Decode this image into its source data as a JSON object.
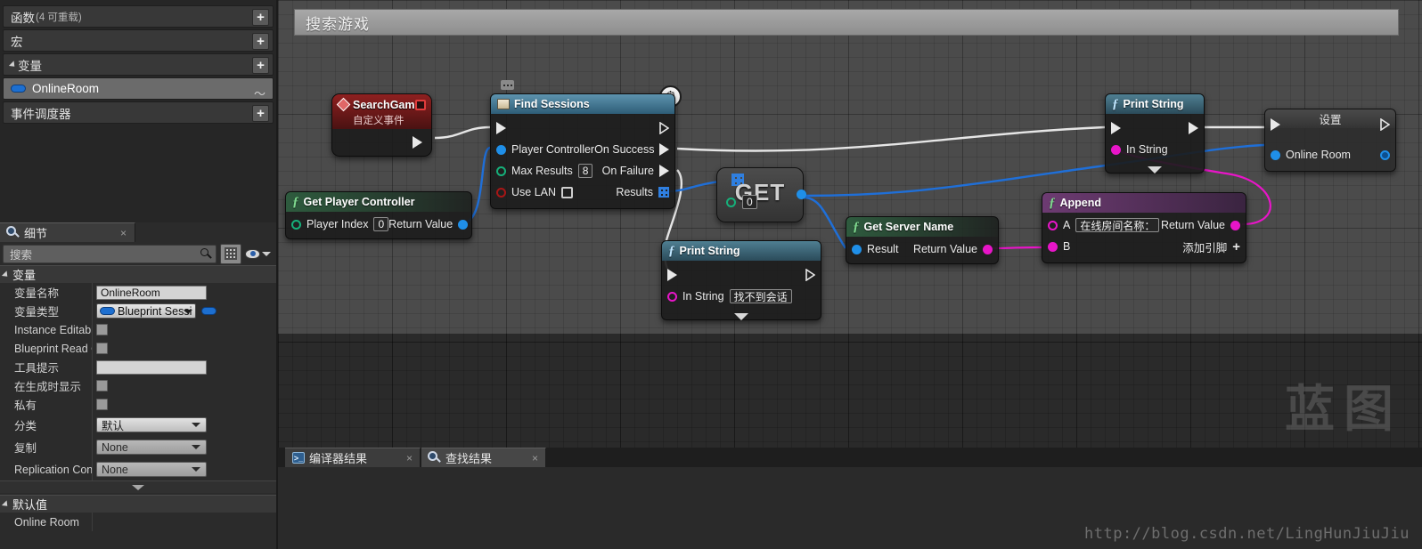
{
  "my_blueprint": {
    "rows": [
      {
        "label": "函数",
        "note": "(4 可重载)",
        "type": "section",
        "name": "functions"
      },
      {
        "label": "宏",
        "note": "",
        "type": "section",
        "name": "macros"
      },
      {
        "label": "变量",
        "note": "",
        "type": "section-open",
        "name": "variables"
      },
      {
        "label": "OnlineRoom",
        "note": "",
        "type": "variable",
        "name": "variable-onlineroom"
      },
      {
        "label": "事件调度器",
        "note": "",
        "type": "section",
        "name": "event-dispatchers"
      }
    ],
    "add_symbol": "+"
  },
  "details": {
    "tab_label": "细节",
    "tab_close": "×",
    "search_placeholder": "搜索",
    "icons": {
      "search": "search-icon",
      "grid": "grid-view-icon",
      "eye": "eye-icon",
      "caret": "chevron-down-icon"
    },
    "sections": [
      {
        "title": "变量"
      },
      {
        "title": "默认值"
      }
    ],
    "properties": [
      {
        "label": "变量名称",
        "value": "OnlineRoom",
        "kind": "text"
      },
      {
        "label": "变量类型",
        "value": "Blueprint Sessi",
        "kind": "type"
      },
      {
        "label": "Instance Editable",
        "value": "",
        "kind": "checkbox"
      },
      {
        "label": "Blueprint Read O",
        "value": "",
        "kind": "checkbox"
      },
      {
        "label": "工具提示",
        "value": "",
        "kind": "text-blank"
      },
      {
        "label": "在生成时显示",
        "value": "",
        "kind": "checkbox"
      },
      {
        "label": "私有",
        "value": "",
        "kind": "checkbox"
      },
      {
        "label": "分类",
        "value": "默认",
        "kind": "combo"
      },
      {
        "label": "复制",
        "value": "None",
        "kind": "combo-dark"
      },
      {
        "label": "Replication Cond",
        "value": "None",
        "kind": "combo-dark"
      }
    ],
    "defaults_section_title": "默认值",
    "defaults_row_label": "Online Room"
  },
  "graph": {
    "title": "搜索游戏",
    "watermark": "蓝图",
    "nodes": {
      "search_game": {
        "title": "SearchGame",
        "subtitle": "自定义事件"
      },
      "find_sessions": {
        "title": "Find Sessions",
        "inputs": [
          {
            "label": "Player Controller",
            "pin": "blue"
          },
          {
            "label": "Max Results",
            "pin": "green-o",
            "value": "8"
          },
          {
            "label": "Use LAN",
            "pin": "red-o",
            "value": false
          }
        ],
        "outputs": [
          {
            "label": "On Success",
            "pin": "exec"
          },
          {
            "label": "On Failure",
            "pin": "exec"
          },
          {
            "label": "Results",
            "pin": "array-blue"
          }
        ]
      },
      "get_player_controller": {
        "title": "Get Player Controller",
        "input_label": "Player Index",
        "input_value": "0",
        "output_label": "Return Value"
      },
      "get_array_element": {
        "title": "GET",
        "index_value": "0"
      },
      "print_string_1": {
        "title": "Print String",
        "in_string_label": "In String",
        "in_string_value": "找不到会话"
      },
      "get_server_name": {
        "title": "Get Server Name",
        "input_label": "Result",
        "output_label": "Return Value"
      },
      "append": {
        "title": "Append",
        "a_label": "A",
        "a_value": "在线房间名称：",
        "b_label": "B",
        "output_label": "Return Value",
        "add_pin_label": "添加引脚",
        "add_pin_symbol": "+"
      },
      "print_string_2": {
        "title": "Print String",
        "in_string_label": "In String"
      },
      "set_node": {
        "title": "设置",
        "pin_label": "Online Room"
      }
    }
  },
  "bottom": {
    "tabs": [
      {
        "label": "编译器结果",
        "close": "×",
        "icon": "terminal-icon"
      },
      {
        "label": "查找结果",
        "close": "×",
        "icon": "search-icon"
      }
    ],
    "url": "http://blog.csdn.net/LingHunJiuJiu"
  },
  "colors": {
    "exec_wire": "#e6e6e6",
    "object_wire": "#1f6fd8",
    "string_wire": "#e815c8",
    "accent_blue": "#1f8fe8"
  }
}
